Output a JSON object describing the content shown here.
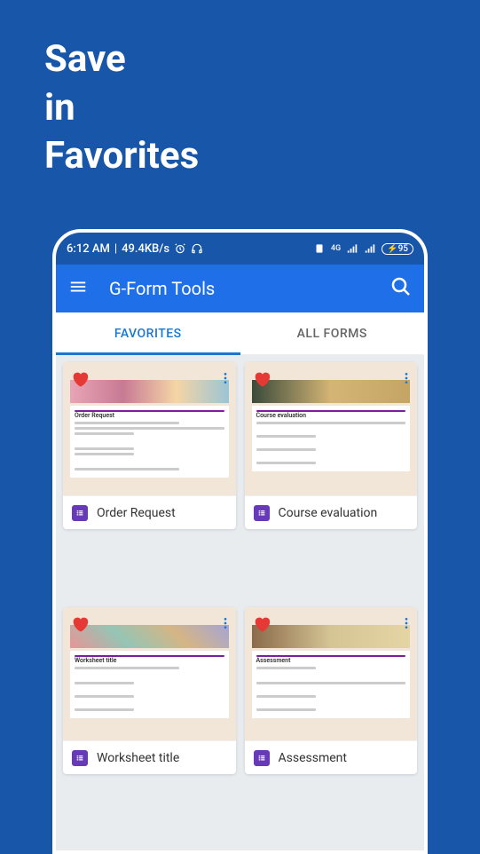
{
  "promo": {
    "line1": "Save",
    "line2": "in",
    "line3": "Favorites"
  },
  "statusBar": {
    "time": "6:12 AM",
    "speed": "49.4KB/s",
    "network": "4G",
    "battery": "95"
  },
  "appBar": {
    "title": "G-Form Tools"
  },
  "tabs": {
    "favorites": "FAVORITES",
    "allForms": "ALL FORMS"
  },
  "cards": [
    {
      "title": "Order Request",
      "previewTitle": "Order Request",
      "headerClass": "flowers"
    },
    {
      "title": "Course evaluation",
      "previewTitle": "Course evaluation",
      "headerClass": "pencils"
    },
    {
      "title": "Worksheet title",
      "previewTitle": "Worksheet title",
      "headerClass": "abstract"
    },
    {
      "title": "Assessment",
      "previewTitle": "Assessment",
      "headerClass": "desk"
    }
  ]
}
